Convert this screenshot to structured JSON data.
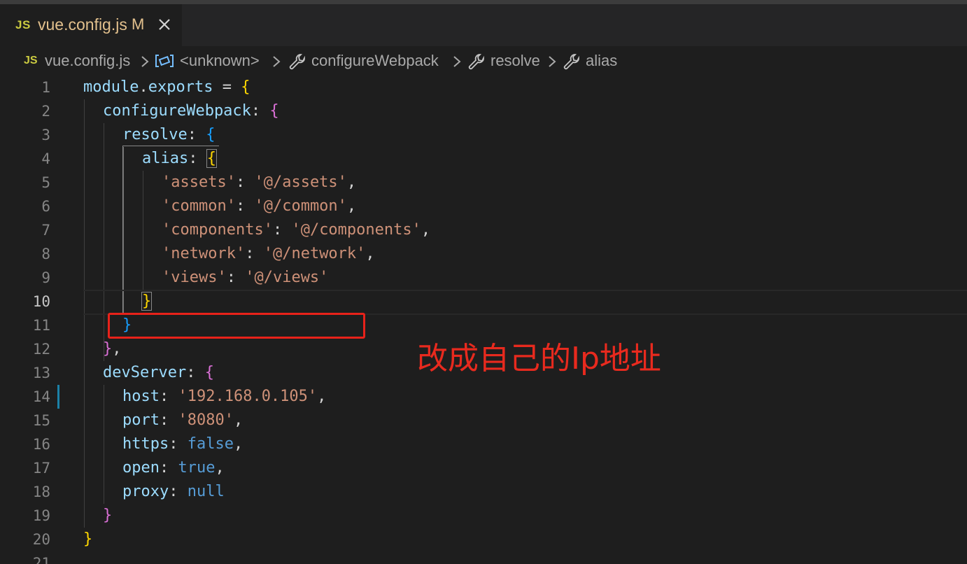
{
  "tab": {
    "icon_label": "JS",
    "filename": "vue.config.js",
    "status": "M",
    "close_icon": "close-icon"
  },
  "breadcrumb": {
    "file_icon": "JS",
    "items": [
      "vue.config.js",
      "<unknown>",
      "configureWebpack",
      "resolve",
      "alias"
    ]
  },
  "editor": {
    "line_numbers": [
      "1",
      "2",
      "3",
      "4",
      "5",
      "6",
      "7",
      "8",
      "9",
      "10",
      "11",
      "12",
      "13",
      "14",
      "15",
      "16",
      "17",
      "18",
      "19",
      "20",
      "21"
    ],
    "active_line": "10",
    "modified_line": "14"
  },
  "code": {
    "l1": {
      "a": "module",
      "b": ".",
      "c": "exports",
      "d": " = ",
      "e": "{"
    },
    "l2": {
      "a": "configureWebpack",
      "b": ": ",
      "c": "{"
    },
    "l3": {
      "a": "resolve",
      "b": ": ",
      "c": "{"
    },
    "l4": {
      "a": "alias",
      "b": ": ",
      "c": "{"
    },
    "l5": {
      "a": "'assets'",
      "b": ": ",
      "c": "'@/assets'",
      "d": ","
    },
    "l6": {
      "a": "'common'",
      "b": ": ",
      "c": "'@/common'",
      "d": ","
    },
    "l7": {
      "a": "'components'",
      "b": ": ",
      "c": "'@/components'",
      "d": ","
    },
    "l8": {
      "a": "'network'",
      "b": ": ",
      "c": "'@/network'",
      "d": ","
    },
    "l9": {
      "a": "'views'",
      "b": ": ",
      "c": "'@/views'"
    },
    "l10": {
      "a": "}"
    },
    "l11": {
      "a": "}"
    },
    "l12": {
      "a": "}",
      "b": ","
    },
    "l13": {
      "a": "devServer",
      "b": ": ",
      "c": "{"
    },
    "l14": {
      "a": "host",
      "b": ": ",
      "c": "'192.168.0.105'",
      "d": ","
    },
    "l15": {
      "a": "port",
      "b": ": ",
      "c": "'8080'",
      "d": ","
    },
    "l16": {
      "a": "https",
      "b": ": ",
      "c": "false",
      "d": ","
    },
    "l17": {
      "a": "open",
      "b": ": ",
      "c": "true",
      "d": ","
    },
    "l18": {
      "a": "proxy",
      "b": ": ",
      "c": "null"
    },
    "l19": {
      "a": "}"
    },
    "l20": {
      "a": "}"
    }
  },
  "annotation": {
    "text": "改成自己的Ip地址",
    "color": "#e82a1e"
  },
  "colors": {
    "editor_bg": "#1e1e1e",
    "string": "#ce9178",
    "property": "#9cdcfe",
    "bracket_gold": "#ffd700",
    "bracket_pink": "#da70d6",
    "bracket_blue": "#179fff",
    "keyword_blue": "#569cd6",
    "highlight_red": "#e8221a"
  }
}
